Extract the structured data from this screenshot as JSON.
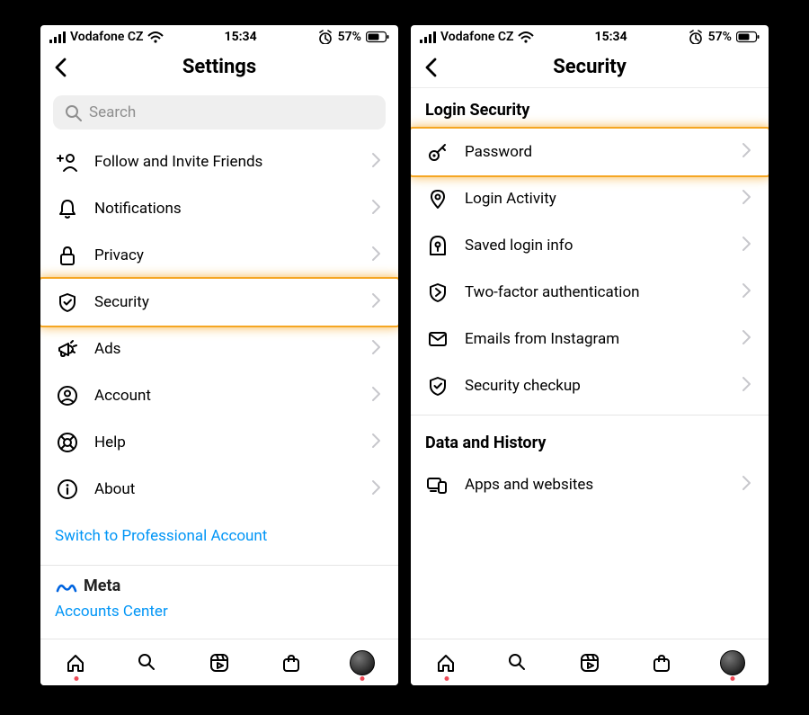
{
  "status": {
    "carrier": "Vodafone CZ",
    "time": "15:34",
    "battery_pct": "57%"
  },
  "left": {
    "title": "Settings",
    "search_placeholder": "Search",
    "items": [
      {
        "icon": "follow",
        "label": "Follow and Invite Friends"
      },
      {
        "icon": "bell",
        "label": "Notifications"
      },
      {
        "icon": "lock",
        "label": "Privacy"
      },
      {
        "icon": "shield",
        "label": "Security",
        "highlight": true
      },
      {
        "icon": "megaphone",
        "label": "Ads"
      },
      {
        "icon": "person",
        "label": "Account"
      },
      {
        "icon": "lifebuoy",
        "label": "Help"
      },
      {
        "icon": "info",
        "label": "About"
      }
    ],
    "switch_link": "Switch to Professional Account",
    "meta_label": "Meta",
    "accounts_center": "Accounts Center"
  },
  "right": {
    "title": "Security",
    "section1": "Login Security",
    "items1": [
      {
        "icon": "key",
        "label": "Password",
        "highlight": true
      },
      {
        "icon": "pin",
        "label": "Login Activity"
      },
      {
        "icon": "keyhole",
        "label": "Saved login info"
      },
      {
        "icon": "shield2",
        "label": "Two-factor authentication"
      },
      {
        "icon": "mail",
        "label": "Emails from Instagram"
      },
      {
        "icon": "shieldcheck",
        "label": "Security checkup"
      }
    ],
    "section2": "Data and History",
    "items2": [
      {
        "icon": "devices",
        "label": "Apps and websites"
      }
    ]
  }
}
